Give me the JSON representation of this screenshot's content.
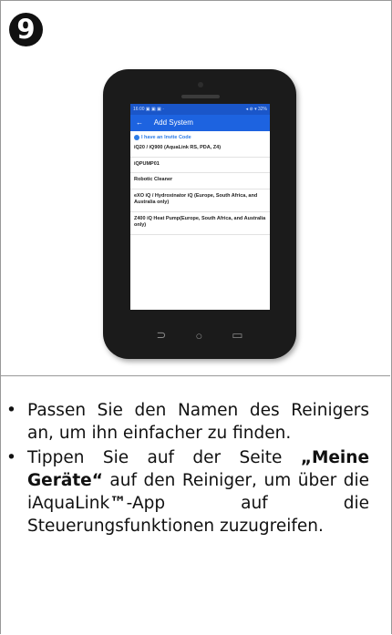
{
  "step_number": "9",
  "phone": {
    "status_left": "16:00 ▣ ▣ ▣ ·",
    "status_right": "◂ ⊘ ▾ 32%",
    "title": "Add System",
    "invite": "I have an Invite Code",
    "items": [
      "iQ20 / iQ900 (AquaLink RS, PDA, Z4)",
      "iQPUMP01",
      "Robotic Cleaner",
      "eXO iQ / Hydroxinator iQ (Europe, South Africa, and Australia only)",
      "Z400 iQ Heat Pump(Europe, South Africa, and Australia only)"
    ],
    "nav": {
      "back": "⊃",
      "home": "○",
      "menu": "▭"
    }
  },
  "bullets": {
    "mark": "•",
    "first": "Passen Sie den Namen des Reinigers an, um ihn einfacher zu finden.",
    "second_a": "Tippen Sie auf der Seite ",
    "second_b": "„Meine Geräte“",
    "second_c": " auf den Reiniger, um über die iAquaLink",
    "second_tm": "™",
    "second_d": "-App auf die Steuerungsfunktionen zuzugreifen."
  }
}
